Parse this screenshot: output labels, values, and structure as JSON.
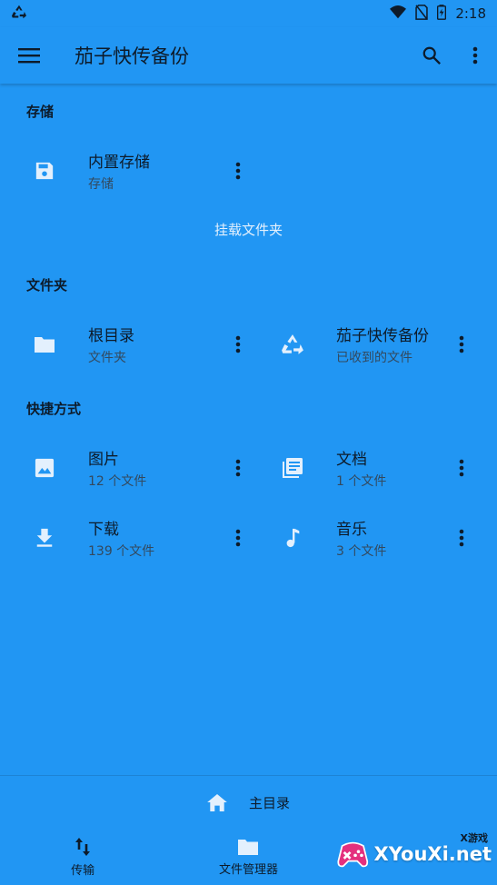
{
  "status_bar": {
    "time": "2:18"
  },
  "appbar": {
    "title": "茄子快传备份"
  },
  "sections": {
    "storage": "存储",
    "folders": "文件夹",
    "shortcuts": "快捷方式"
  },
  "storage_items": [
    {
      "title": "内置存储",
      "subtitle": "存储"
    }
  ],
  "mount_label": "挂载文件夹",
  "folder_items": [
    {
      "title": "根目录",
      "subtitle": "文件夹"
    },
    {
      "title": "茄子快传备份",
      "subtitle": "已收到的文件"
    }
  ],
  "shortcut_items": [
    {
      "title": "图片",
      "subtitle": "12 个文件"
    },
    {
      "title": "文档",
      "subtitle": "1 个文件"
    },
    {
      "title": "下载",
      "subtitle": "139 个文件"
    },
    {
      "title": "音乐",
      "subtitle": "3 个文件"
    }
  ],
  "home_row": {
    "label": "主目录"
  },
  "bottom_nav": [
    {
      "label": "传输"
    },
    {
      "label": "文件管理器"
    }
  ],
  "watermark": {
    "text": "XYouXi.net",
    "tag": "X游戏"
  },
  "colors": {
    "background": "#2196F3",
    "text": "#0d1b2a",
    "secondary_text": "#33495e"
  }
}
